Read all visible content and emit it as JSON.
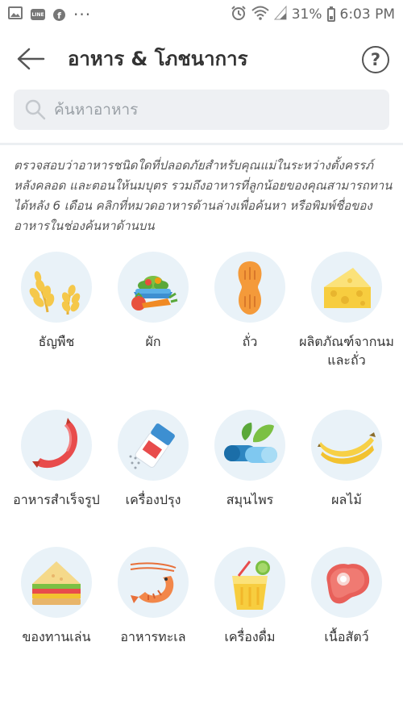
{
  "status_bar": {
    "battery": "31%",
    "time": "6:03 PM",
    "more": "···",
    "line_label": "LINE",
    "fb_label": "f"
  },
  "header": {
    "title": "อาหาร & โภชนาการ",
    "help_symbol": "?"
  },
  "search": {
    "placeholder": "ค้นหาอาหาร"
  },
  "description": "ตรวจสอบว่าอาหารชนิดใดที่ปลอดภัยสำหรับคุณแม่ในระหว่างตั้งครรภ์ หลังคลอด และตอนให้นมบุตร รวมถึงอาหารที่ลูกน้อยของคุณสามารถทานได้หลัง 6 เดือน คลิกที่หมวดอาหารด้านล่างเพื่อค้นหา หรือพิมพ์ชื่อของอาหารในช่องค้นหาด้านบน",
  "categories": [
    {
      "label": "ธัญพืช",
      "icon": "grain-icon"
    },
    {
      "label": "ผัก",
      "icon": "vegetables-icon"
    },
    {
      "label": "ถั่ว",
      "icon": "peanut-icon"
    },
    {
      "label": "ผลิตภัณฑ์จากนมและถั่ว",
      "icon": "cheese-icon"
    },
    {
      "label": "อาหารสำเร็จรูป",
      "icon": "sausage-icon"
    },
    {
      "label": "เครื่องปรุง",
      "icon": "salt-shaker-icon"
    },
    {
      "label": "สมุนไพร",
      "icon": "herbs-capsule-icon"
    },
    {
      "label": "ผลไม้",
      "icon": "banana-icon"
    },
    {
      "label": "ของทานเล่น",
      "icon": "sandwich-icon"
    },
    {
      "label": "อาหารทะเล",
      "icon": "shrimp-icon"
    },
    {
      "label": "เครื่องดื่ม",
      "icon": "drink-icon"
    },
    {
      "label": "เนื้อสัตว์",
      "icon": "meat-icon"
    }
  ],
  "colors": {
    "icon_bg": "#e9f2f8",
    "search_bg": "#eef0f3",
    "text_primary": "#333333",
    "text_secondary": "#555555"
  }
}
